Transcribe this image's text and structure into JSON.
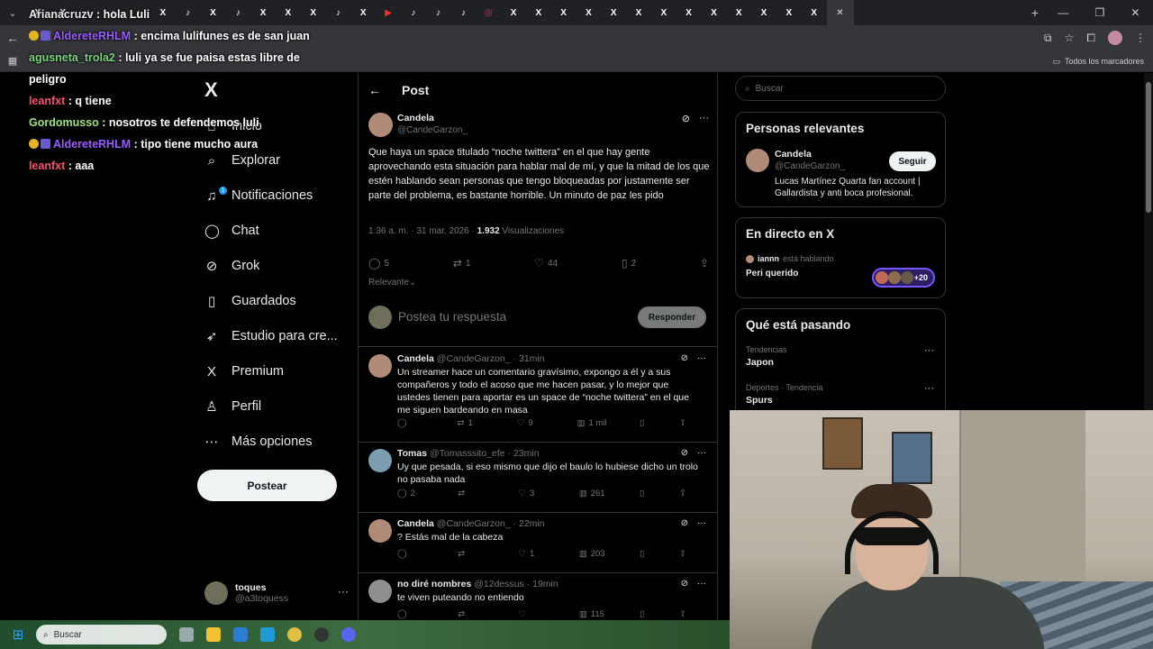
{
  "browser": {
    "tab_dropdown": "⌄",
    "tabs": [
      {
        "icon": "x-icon",
        "glyph": "X",
        "color": "#ffffff"
      },
      {
        "icon": "x-icon",
        "glyph": "X",
        "color": "#ffffff"
      },
      {
        "icon": "tiktok-icon",
        "glyph": "♪",
        "color": "#ffffff"
      },
      {
        "icon": "tiktok-icon",
        "glyph": "♪",
        "color": "#ffffff"
      },
      {
        "icon": "tiktok-icon",
        "glyph": "♪",
        "color": "#ffffff"
      },
      {
        "icon": "x-icon",
        "glyph": "X",
        "color": "#ffffff"
      },
      {
        "icon": "tiktok-icon",
        "glyph": "♪",
        "color": "#ffffff"
      },
      {
        "icon": "x-icon",
        "glyph": "X",
        "color": "#ffffff"
      },
      {
        "icon": "tiktok-icon",
        "glyph": "♪",
        "color": "#ffffff"
      },
      {
        "icon": "x-icon",
        "glyph": "X",
        "color": "#ffffff"
      },
      {
        "icon": "x-icon",
        "glyph": "X",
        "color": "#ffffff"
      },
      {
        "icon": "x-icon",
        "glyph": "X",
        "color": "#ffffff"
      },
      {
        "icon": "tiktok-icon",
        "glyph": "♪",
        "color": "#ffffff"
      },
      {
        "icon": "x-icon",
        "glyph": "X",
        "color": "#ffffff"
      },
      {
        "icon": "youtube-icon",
        "glyph": "▶",
        "color": "#ff2d2d"
      },
      {
        "icon": "tiktok-icon",
        "glyph": "♪",
        "color": "#ffffff"
      },
      {
        "icon": "tiktok-icon",
        "glyph": "♪",
        "color": "#ffffff"
      },
      {
        "icon": "tiktok-icon",
        "glyph": "♪",
        "color": "#ffffff"
      },
      {
        "icon": "instagram-icon",
        "glyph": "◎",
        "color": "#e1306c"
      },
      {
        "icon": "x-icon",
        "glyph": "X",
        "color": "#ffffff"
      },
      {
        "icon": "x-icon",
        "glyph": "X",
        "color": "#ffffff"
      },
      {
        "icon": "x-icon",
        "glyph": "X",
        "color": "#ffffff"
      },
      {
        "icon": "x-icon",
        "glyph": "X",
        "color": "#ffffff"
      },
      {
        "icon": "x-icon",
        "glyph": "X",
        "color": "#ffffff"
      },
      {
        "icon": "x-icon",
        "glyph": "X",
        "color": "#ffffff"
      },
      {
        "icon": "x-icon",
        "glyph": "X",
        "color": "#ffffff"
      },
      {
        "icon": "x-icon",
        "glyph": "X",
        "color": "#ffffff"
      },
      {
        "icon": "x-icon",
        "glyph": "X",
        "color": "#ffffff"
      },
      {
        "icon": "x-icon",
        "glyph": "X",
        "color": "#ffffff"
      },
      {
        "icon": "x-icon",
        "glyph": "X",
        "color": "#ffffff"
      },
      {
        "icon": "x-icon",
        "glyph": "X",
        "color": "#ffffff"
      },
      {
        "icon": "x-icon",
        "glyph": "X",
        "color": "#ffffff"
      }
    ],
    "active_tab_close": "✕",
    "new_tab": "+",
    "window_controls": [
      "—",
      "❐",
      "✕"
    ],
    "all_bookmarks": "Todos los marcadores"
  },
  "chat": [
    {
      "user": "Arianacruzv",
      "text": " : hola Luli",
      "color": "#e7e9ea",
      "badges": 0
    },
    {
      "user": "AldereteRHLM",
      "text": " : encima lulifunes es de san juan",
      "color": "#9a5cff",
      "badges": 2
    },
    {
      "user": "agusneta_trola2",
      "text": " : luli ya se fue paisa estas libre de",
      "color": "#7ad37a",
      "badges": 0
    },
    {
      "user": "",
      "text": "peligro",
      "color": "#e7e9ea",
      "badges": 0
    },
    {
      "user": "leanfxt",
      "text": " : q tiene",
      "color": "#ff4d6d",
      "badges": 0
    },
    {
      "user": "Gordomusso",
      "text": " : nosotros te defendemos luli",
      "color": "#9be37a",
      "badges": 0
    },
    {
      "user": "AldereteRHLM",
      "text": " : tipo tiene mucho aura",
      "color": "#9a5cff",
      "badges": 2
    },
    {
      "user": "leanfxt",
      "text": " : aaa",
      "color": "#ff4d6d",
      "badges": 0
    }
  ],
  "nav": {
    "logo": "X",
    "items": [
      {
        "label": "Inicio",
        "icon": "home-icon",
        "glyph": "⌂"
      },
      {
        "label": "Explorar",
        "icon": "search-icon",
        "glyph": "⌕"
      },
      {
        "label": "Notificaciones",
        "icon": "bell-icon",
        "glyph": "♫"
      },
      {
        "label": "Chat",
        "icon": "chat-icon",
        "glyph": "◯"
      },
      {
        "label": "Grok",
        "icon": "grok-icon",
        "glyph": "⊘"
      },
      {
        "label": "Guardados",
        "icon": "bookmark-icon",
        "glyph": "▯"
      },
      {
        "label": "Estudio para cre...",
        "icon": "rocket-icon",
        "glyph": "➶"
      },
      {
        "label": "Premium",
        "icon": "x-premium-icon",
        "glyph": "X"
      },
      {
        "label": "Perfil",
        "icon": "person-icon",
        "glyph": "♙"
      },
      {
        "label": "Más opciones",
        "icon": "more-icon",
        "glyph": "⋯"
      }
    ],
    "notif_count": "1",
    "post_button": "Postear",
    "account_name": "toques",
    "account_handle": "@a3toquess",
    "account_more": "···"
  },
  "post": {
    "header_title": "Post",
    "author": "Candela",
    "handle": "@CandeGarzon_",
    "text": "Que haya un space titulado “noche twittera” en el que hay gente aprovechando esta situación para hablar mal de mí, y que la mitad de los que estén hablando sean personas que tengo bloqueadas por justamente ser parte del problema, es bastante horrible. Un minuto de paz les pido",
    "time": "1:36 a. m. · 31 mar. 2026 · ",
    "views": "1.932",
    "views_label": " Visualizaciones",
    "replies": "5",
    "reposts": "1",
    "likes": "44",
    "bookmarks": "2",
    "sort": "Relevante",
    "more": "···"
  },
  "compose": {
    "placeholder": "Postea tu respuesta",
    "button": "Responder"
  },
  "replies": [
    {
      "name": "Candela",
      "handle": "@CandeGarzon_ · 31min",
      "text": "Un streamer hace un comentario gravísimo, expongo a él y a sus compañeros y todo el acoso que me hacen pasar, y lo mejor que ustedes tienen para aportar es un space de “noche twittera” en el que me siguen bardeando en masa",
      "replies": "",
      "reposts": "1",
      "likes": "9",
      "views": "1 mil",
      "avatar": "#b08b78"
    },
    {
      "name": "Tomas",
      "handle": "@Tomasssito_efe · 23min",
      "text": "Uy que pesada, si eso mismo  que dijo el baulo lo hubiese dicho un trolo no pasaba nada",
      "replies": "2",
      "reposts": "",
      "likes": "3",
      "views": "261",
      "avatar": "#7c9cb0"
    },
    {
      "name": "Candela",
      "handle": "@CandeGarzon_ · 22min",
      "text": "? Estás mal de la cabeza",
      "replies": "",
      "reposts": "",
      "likes": "1",
      "views": "203",
      "avatar": "#b08b78"
    },
    {
      "name": "no diré nombres",
      "handle": "@12dessus · 19min",
      "text": "te viven puteando no entiendo",
      "replies": "",
      "reposts": "",
      "likes": "",
      "views": "115",
      "avatar": "#8e8e8e"
    }
  ],
  "sidebar": {
    "search_placeholder": "Buscar",
    "relevant_title": "Personas relevantes",
    "relevant_name": "Candela",
    "relevant_handle": "@CandeGarzon_",
    "relevant_bio": "Lucas Martínez Quarta fan account | Gallardista y anti boca profesional.",
    "follow_button": "Seguir",
    "live_title": "En directo en X",
    "live_host": "iannn",
    "live_host_suffix": " está hablando",
    "live_space": "Peri querido",
    "live_count": "+20",
    "trends_title": "Qué está pasando",
    "trends": [
      {
        "category": "Tendencias",
        "name": "Japon"
      },
      {
        "category": "Deportes · Tendencia",
        "name": "Spurs"
      }
    ]
  },
  "taskbar": {
    "search_placeholder": "Buscar",
    "start_icon": "⊞"
  }
}
